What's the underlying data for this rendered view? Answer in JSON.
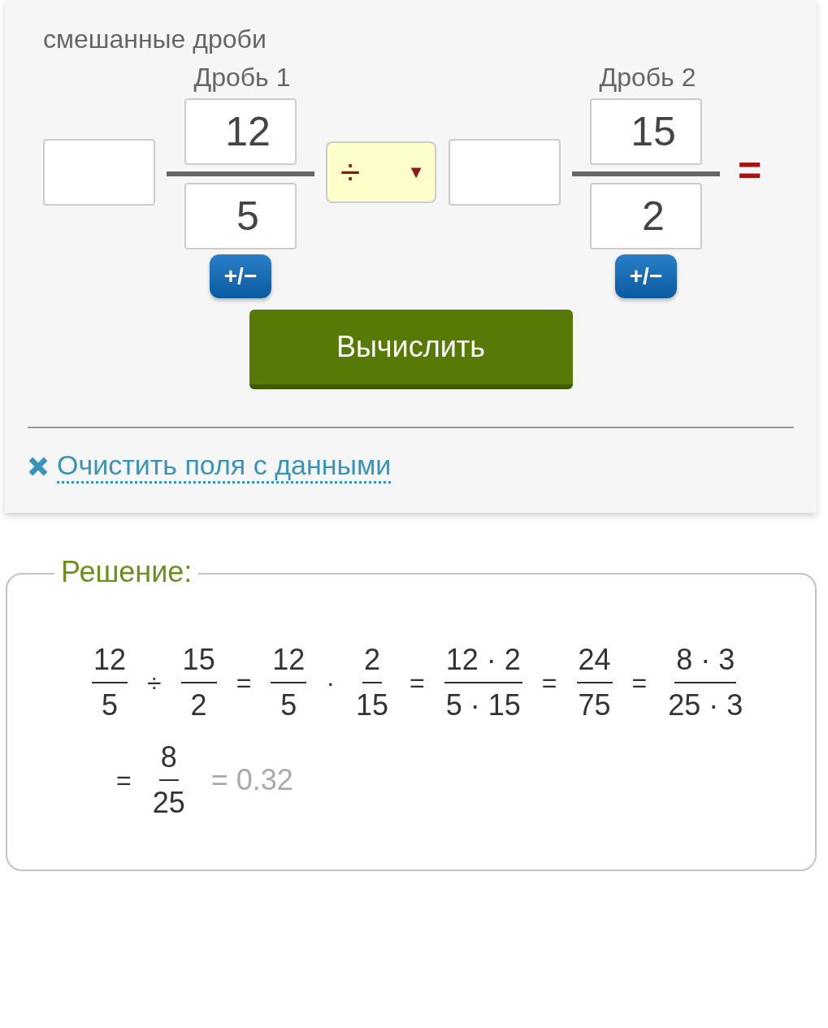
{
  "fraction_type": {
    "label": "смешанные дроби"
  },
  "fractions": [
    {
      "title": "Дробь 1",
      "numerator": "12",
      "denominator": "5",
      "sign_button": "+/−"
    },
    {
      "title": "Дробь 2",
      "numerator": "15",
      "denominator": "2",
      "sign_button": "+/−"
    }
  ],
  "operator": {
    "value": "÷",
    "caret": "▼"
  },
  "equals": "=",
  "compute_button": "Вычислить",
  "clear_link": "Очистить поля с данными",
  "solution": {
    "legend": "Решение:",
    "lines": [
      [
        {
          "kind": "fraction",
          "num": "12",
          "den": "5"
        },
        {
          "kind": "op",
          "text": "÷"
        },
        {
          "kind": "fraction",
          "num": "15",
          "den": "2"
        },
        {
          "kind": "op",
          "text": "="
        },
        {
          "kind": "fraction",
          "num": "12",
          "den": "5"
        },
        {
          "kind": "op",
          "text": "·"
        },
        {
          "kind": "fraction",
          "num": "2",
          "den": "15"
        },
        {
          "kind": "op",
          "text": "="
        },
        {
          "kind": "fraction",
          "num": "12 · 2",
          "den": "5 · 15"
        },
        {
          "kind": "op",
          "text": "="
        },
        {
          "kind": "fraction",
          "num": "24",
          "den": "75"
        },
        {
          "kind": "op",
          "text": "="
        },
        {
          "kind": "fraction",
          "num": "8 · 3",
          "den": "25 · 3"
        }
      ],
      [
        {
          "kind": "op",
          "text": "="
        },
        {
          "kind": "fraction",
          "num": "8",
          "den": "25"
        },
        {
          "kind": "decimal",
          "text": "= 0.32"
        }
      ]
    ]
  }
}
